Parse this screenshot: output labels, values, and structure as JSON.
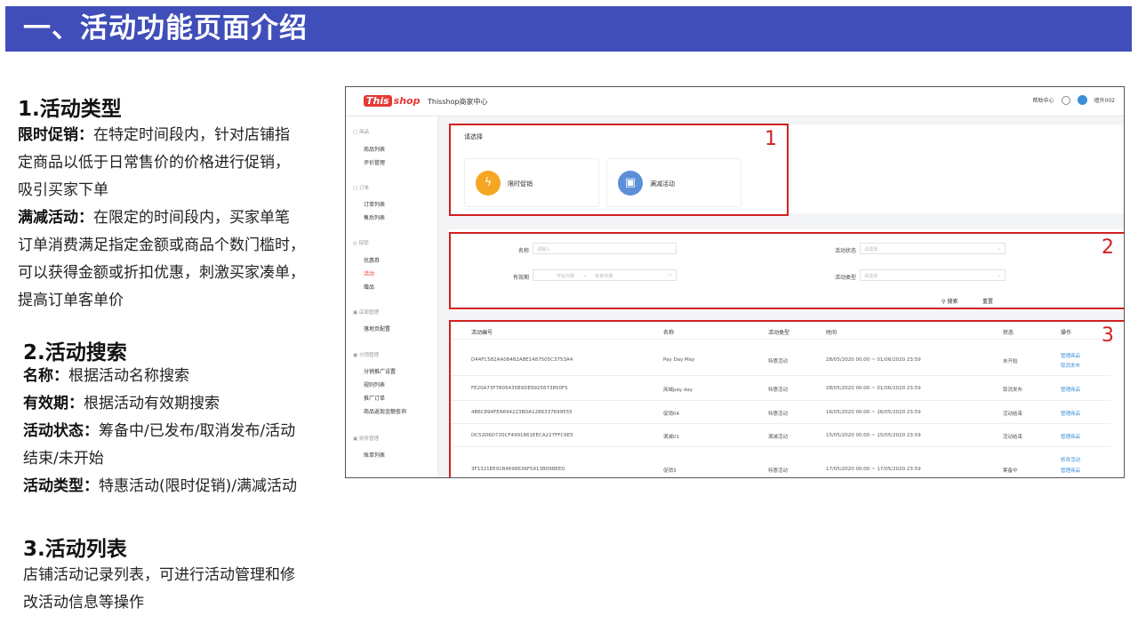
{
  "header": {
    "title": "一、活动功能页面介绍"
  },
  "sections": {
    "type": {
      "heading": "1.活动类型",
      "item1_term": "限时促销：",
      "item1_line1": "在特定时间段内，针对店铺指",
      "item1_line2": "定商品以低于日常售价的价格进行促销，",
      "item1_line3": "吸引买家下单",
      "item2_term": "满减活动：",
      "item2_line1": "在限定的时间段内，买家单笔",
      "item2_line2": "订单消费满足指定金额或商品个数门槛时，",
      "item2_line3": "可以获得金额或折扣优惠，刺激买家凑单，",
      "item2_line4": "提高订单客单价"
    },
    "search": {
      "heading": "2.活动搜索",
      "name_term": "名称：",
      "name_desc": "根据活动名称搜索",
      "period_term": "有效期：",
      "period_desc": "根据活动有效期搜索",
      "status_term": "活动状态：",
      "status_desc_line1": "筹备中/已发布/取消发布/活动",
      "status_desc_line2": "结束/未开始",
      "kind_term": "活动类型：",
      "kind_desc": "特惠活动(限时促销)/满减活动"
    },
    "list": {
      "heading": "3.活动列表",
      "desc_line1": "店铺活动记录列表，可进行活动管理和修",
      "desc_line2": "改活动信息等操作"
    }
  },
  "app": {
    "logo_this": "This",
    "logo_shop": "shop",
    "title": "Thisshop商家中心",
    "help": "帮助中心",
    "user": "墙外002",
    "sidebar": {
      "groups": [
        {
          "label": "商品",
          "items": [
            "商品列表",
            "评价管理"
          ]
        },
        {
          "label": "订单",
          "items": [
            "订单列表",
            "售后列表"
          ]
        },
        {
          "label": "促销",
          "items": [
            "优惠券",
            "活动",
            "赠品"
          ]
        },
        {
          "label": "店面管理",
          "items": [
            "落地页配置"
          ]
        },
        {
          "label": "分销管理",
          "items": [
            "分销推广设置",
            "规则列表",
            "推广订单",
            "商品返现金额查询"
          ]
        },
        {
          "label": "财务管理",
          "items": [
            "账单列表"
          ]
        }
      ]
    },
    "select_panel": {
      "label": "请选择",
      "card1": "限时促销",
      "card2": "满减活动"
    },
    "filters": {
      "name_label": "名称",
      "name_placeholder": "请输入",
      "period_label": "有效期",
      "start_placeholder": "开始日期",
      "end_placeholder": "结束日期",
      "status_label": "活动状态",
      "status_placeholder": "请选择",
      "type_label": "活动类型",
      "type_placeholder": "请选择",
      "search_btn": "搜索",
      "reset_btn": "重置"
    },
    "table": {
      "headers": [
        "活动编号",
        "名称",
        "活动类型",
        "时间",
        "状态",
        "操作"
      ],
      "rows": [
        {
          "id": "D44FC582AA08482A8E1487505C3753A4",
          "name": "Pay Day May",
          "type": "特惠活动",
          "time": "28/05/2020 00:00 ~ 01/06/2020 23:59",
          "status": "未开始",
          "op1": "管理商品",
          "op2": "取消发布"
        },
        {
          "id": "FE20A73F7805435B9DE9925673850F5",
          "name": "商城pay day",
          "type": "特惠活动",
          "time": "28/05/2020 00:00 ~ 01/06/2020 23:59",
          "status": "取消发布",
          "op1": "管理商品",
          "op2": ""
        },
        {
          "id": "4B6C894FEA694223BDA1286337699555",
          "name": "促销04",
          "type": "特惠活动",
          "time": "16/05/2020 00:00 ~ 16/05/2020 23:59",
          "status": "活动结束",
          "op1": "管理商品",
          "op2": ""
        },
        {
          "id": "DC52D6D720CF4991861EECA227FFC6E5",
          "name": "满减01",
          "type": "满减活动",
          "time": "15/05/2020 00:00 ~ 15/05/2020 23:59",
          "status": "活动结束",
          "op1": "管理商品",
          "op2": ""
        },
        {
          "id": "3F1321EE91B4698636F5913B098EED",
          "name": "促销3",
          "type": "特惠活动",
          "time": "17/05/2020 00:00 ~ 17/05/2020 23:59",
          "status": "筹备中",
          "op1": "修改活动",
          "op2": "管理商品"
        }
      ]
    }
  },
  "annotations": {
    "label1": "1",
    "label2": "2",
    "label3": "3"
  },
  "colors": {
    "banner": "#3f4eb8",
    "annotation_red": "#d32020",
    "accent_blue": "#3a8fd8"
  }
}
